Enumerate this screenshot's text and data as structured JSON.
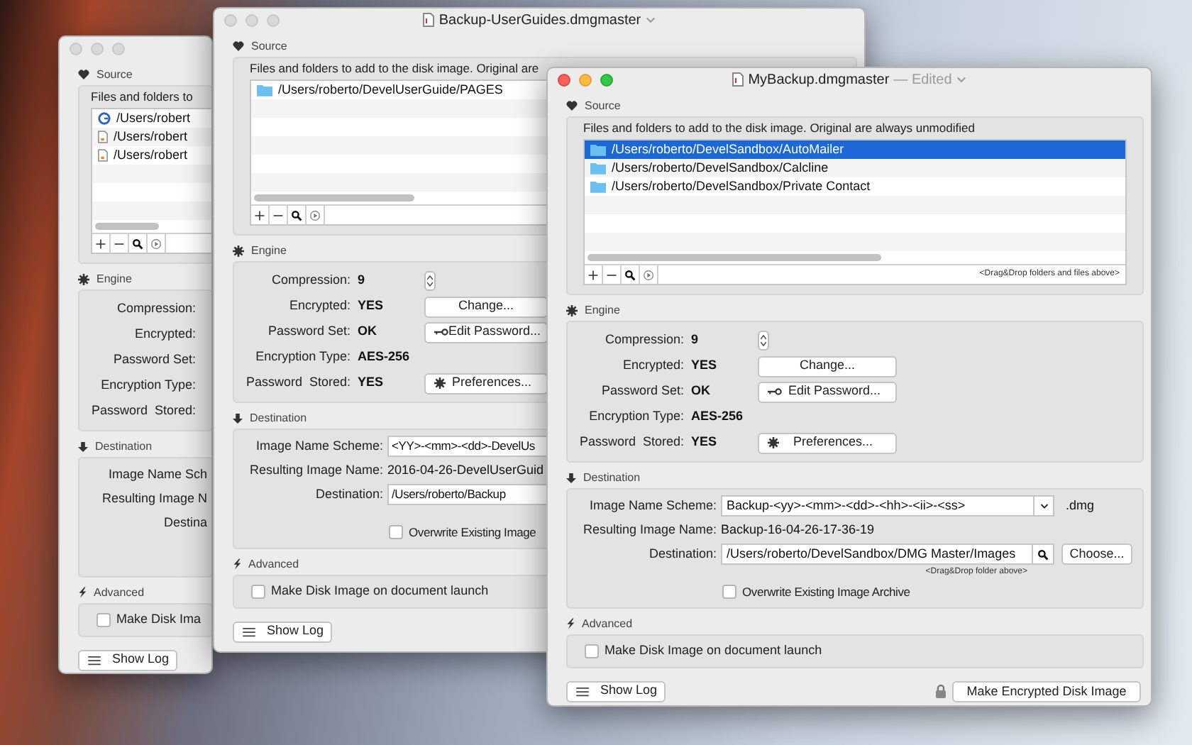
{
  "windows": [
    {
      "active": false,
      "source": {
        "heading": "Source",
        "description": "Files and folders to",
        "items": [
          {
            "path": "/Users/robert",
            "kind": "app",
            "selected": false
          },
          {
            "path": "/Users/robert",
            "kind": "document",
            "selected": false
          },
          {
            "path": "/Users/robert",
            "kind": "document",
            "selected": false
          }
        ]
      },
      "engine": {
        "heading": "Engine",
        "rows": [
          {
            "label": "Compression:",
            "kind": "text"
          },
          {
            "label": "Encrypted:",
            "kind": "text"
          },
          {
            "label": "Password Set:",
            "kind": "text"
          },
          {
            "label": "Encryption Type:",
            "kind": "text"
          },
          {
            "label": "Password  Stored:",
            "kind": "text"
          }
        ]
      },
      "destination": {
        "heading": "Destination",
        "rows": [
          {
            "label": "Image Name Sch",
            "kind": "text"
          },
          {
            "label": "Resulting Image N",
            "kind": "text"
          },
          {
            "label": "Destina",
            "kind": "text"
          }
        ]
      },
      "advanced": {
        "heading": "Advanced",
        "launch": {
          "label": "Make Disk Ima",
          "checked": false
        }
      },
      "show_log": "Show Log"
    },
    {
      "active": false,
      "title": "Backup-UserGuides.dmgmaster",
      "source": {
        "heading": "Source",
        "description": "Files and folders to add to the disk image. Original are",
        "items": [
          {
            "path": "/Users/roberto/DevelUserGuide/PAGES",
            "kind": "folder",
            "selected": false
          }
        ]
      },
      "engine": {
        "heading": "Engine",
        "rows": [
          {
            "label": "Compression:",
            "value": "9",
            "kind": "stepper"
          },
          {
            "label": "Encrypted:",
            "value": "YES",
            "kind": "button",
            "button": "Change..."
          },
          {
            "label": "Password Set:",
            "value": "OK",
            "kind": "key_button",
            "button": "Edit Password..."
          },
          {
            "label": "Encryption Type:",
            "value": "AES-256",
            "kind": "text"
          },
          {
            "label": "Password  Stored:",
            "value": "YES",
            "kind": "gear_button",
            "button": "Preferences..."
          }
        ]
      },
      "destination": {
        "heading": "Destination",
        "rows": [
          {
            "label": "Image Name Scheme:",
            "value": "<YY>-<mm>-<dd>-DevelUs",
            "kind": "field"
          },
          {
            "label": "Resulting Image Name:",
            "value": "2016-04-26-DevelUserGuid",
            "kind": "text"
          },
          {
            "label": "Destination:",
            "value": "/Users/roberto/Backup",
            "kind": "field"
          }
        ],
        "overwrite": {
          "label": "Overwrite Existing Image",
          "checked": false
        }
      },
      "advanced": {
        "heading": "Advanced",
        "launch": {
          "label": "Make Disk Image on document launch",
          "checked": false
        }
      },
      "show_log": "Show Log"
    },
    {
      "active": true,
      "title": "MyBackup.dmgmaster",
      "edited": "— Edited",
      "source": {
        "heading": "Source",
        "description": "Files and folders to add to the disk image. Original are always unmodified",
        "items": [
          {
            "path": "/Users/roberto/DevelSandbox/AutoMailer",
            "kind": "folder",
            "selected": true
          },
          {
            "path": "/Users/roberto/DevelSandbox/Calcline",
            "kind": "folder",
            "selected": false
          },
          {
            "path": "/Users/roberto/DevelSandbox/Private Contact",
            "kind": "folder",
            "selected": false
          }
        ],
        "hint": "<Drag&Drop folders and files above>"
      },
      "engine": {
        "heading": "Engine",
        "rows": [
          {
            "label": "Compression:",
            "value": "9",
            "kind": "stepper"
          },
          {
            "label": "Encrypted:",
            "value": "YES",
            "kind": "button",
            "button": "Change..."
          },
          {
            "label": "Password Set:",
            "value": "OK",
            "kind": "key_button",
            "button": "Edit Password..."
          },
          {
            "label": "Encryption Type:",
            "value": "AES-256",
            "kind": "text"
          },
          {
            "label": "Password  Stored:",
            "value": "YES",
            "kind": "gear_button",
            "button": "Preferences..."
          }
        ]
      },
      "destination": {
        "heading": "Destination",
        "rows": [
          {
            "label": "Image Name Scheme:",
            "value": "Backup-<yy>-<mm>-<dd>-<hh>-<ii>-<ss>",
            "kind": "combo",
            "suffix": ".dmg"
          },
          {
            "label": "Resulting Image Name:",
            "value": "Backup-16-04-26-17-36-19",
            "kind": "text"
          },
          {
            "label": "Destination:",
            "value": "/Users/roberto/DevelSandbox/DMG Master/Images",
            "kind": "path",
            "button": "Choose...",
            "hint": "<Drag&Drop folder above>"
          }
        ],
        "overwrite": {
          "label": "Overwrite Existing Image Archive",
          "checked": false
        }
      },
      "advanced": {
        "heading": "Advanced",
        "launch": {
          "label": "Make Disk Image on document launch",
          "checked": false
        }
      },
      "show_log": "Show Log",
      "make_button": "Make Encrypted Disk Image"
    }
  ]
}
